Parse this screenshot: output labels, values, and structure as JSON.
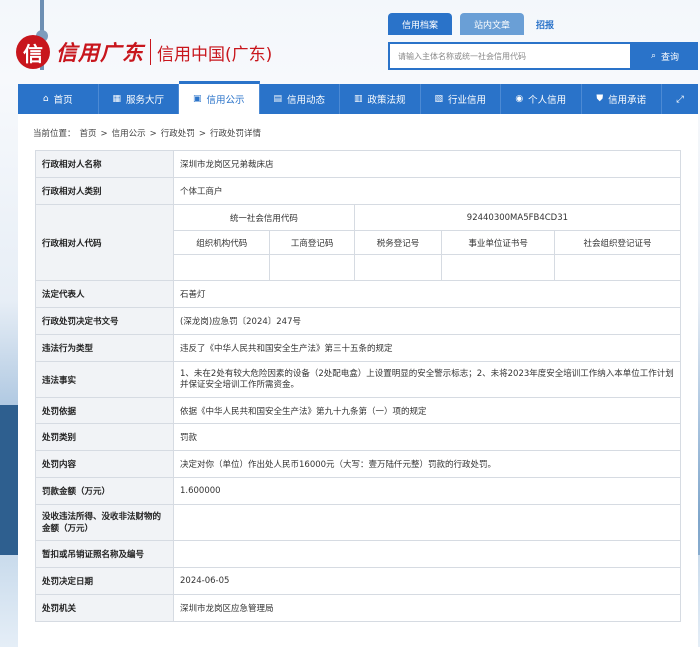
{
  "header": {
    "logo_mark": "信",
    "brand_cn": "信用广东",
    "brand_name": "信用中国(广东)",
    "tabs": [
      "信用档案",
      "站内文章"
    ],
    "tab_extra": "招报",
    "search_placeholder": "请输入主体名称或统一社会信用代码",
    "search_button": "查询"
  },
  "nav": {
    "items": [
      {
        "label": "首页",
        "icon": "home-icon",
        "glyph": "⌂"
      },
      {
        "label": "服务大厅",
        "icon": "service-icon",
        "glyph": "▦"
      },
      {
        "label": "信用公示",
        "icon": "bulletin-icon",
        "glyph": "▣"
      },
      {
        "label": "信用动态",
        "icon": "news-icon",
        "glyph": "▤"
      },
      {
        "label": "政策法规",
        "icon": "policy-icon",
        "glyph": "▥"
      },
      {
        "label": "行业信用",
        "icon": "industry-icon",
        "glyph": "▧"
      },
      {
        "label": "个人信用",
        "icon": "person-icon",
        "glyph": "◉"
      },
      {
        "label": "信用承诺",
        "icon": "shield-icon",
        "glyph": "⛊"
      }
    ],
    "extra_icon": "expand-icon",
    "extra_glyph": "⤢"
  },
  "breadcrumb": {
    "prefix": "当前位置：",
    "items": [
      "首页",
      "信用公示",
      "行政处罚",
      "行政处罚详情"
    ],
    "sep": ">"
  },
  "record": {
    "name_label": "行政相对人名称",
    "name": "深圳市龙岗区兄弟裁床店",
    "type_label": "行政相对人类别",
    "type": "个体工商户",
    "code_label": "行政相对人代码",
    "uscc_label": "统一社会信用代码",
    "uscc": "92440300MA5FB4CD31",
    "org_code_label": "组织机构代码",
    "biz_reg_label": "工商登记码",
    "tax_reg_label": "税务登记号",
    "inst_cert_label": "事业单位证书号",
    "social_org_label": "社会组织登记证号",
    "rep_label": "法定代表人",
    "rep": "石善灯",
    "doc_label": "行政处罚决定书文号",
    "doc": "(深龙岗)应急罚〔2024〕247号",
    "viol_type_label": "违法行为类型",
    "viol_type": "违反了《中华人民共和国安全生产法》第三十五条的规定",
    "facts_label": "违法事实",
    "facts": "1、未在2处有较大危险因素的设备（2处配电盒）上设置明显的安全警示标志；2、未将2023年度安全培训工作纳入本单位工作计划并保证安全培训工作所需资金。",
    "basis_label": "处罚依据",
    "basis": "依据《中华人民共和国安全生产法》第九十九条第（一）项的规定",
    "cat_label": "处罚类别",
    "cat": "罚款",
    "content_label": "处罚内容",
    "content": "决定对你（单位）作出处人民币16000元（大写：壹万陆仟元整）罚款的行政处罚。",
    "amount_label": "罚款金额（万元）",
    "amount": "1.600000",
    "confisc_label": "没收违法所得、没收非法财物的金额（万元）",
    "confisc": "",
    "revoke_label": "暂扣或吊销证照名称及编号",
    "revoke": "",
    "date_label": "处罚决定日期",
    "date": "2024-06-05",
    "org_label": "处罚机关",
    "org": "深圳市龙岗区应急管理局"
  }
}
